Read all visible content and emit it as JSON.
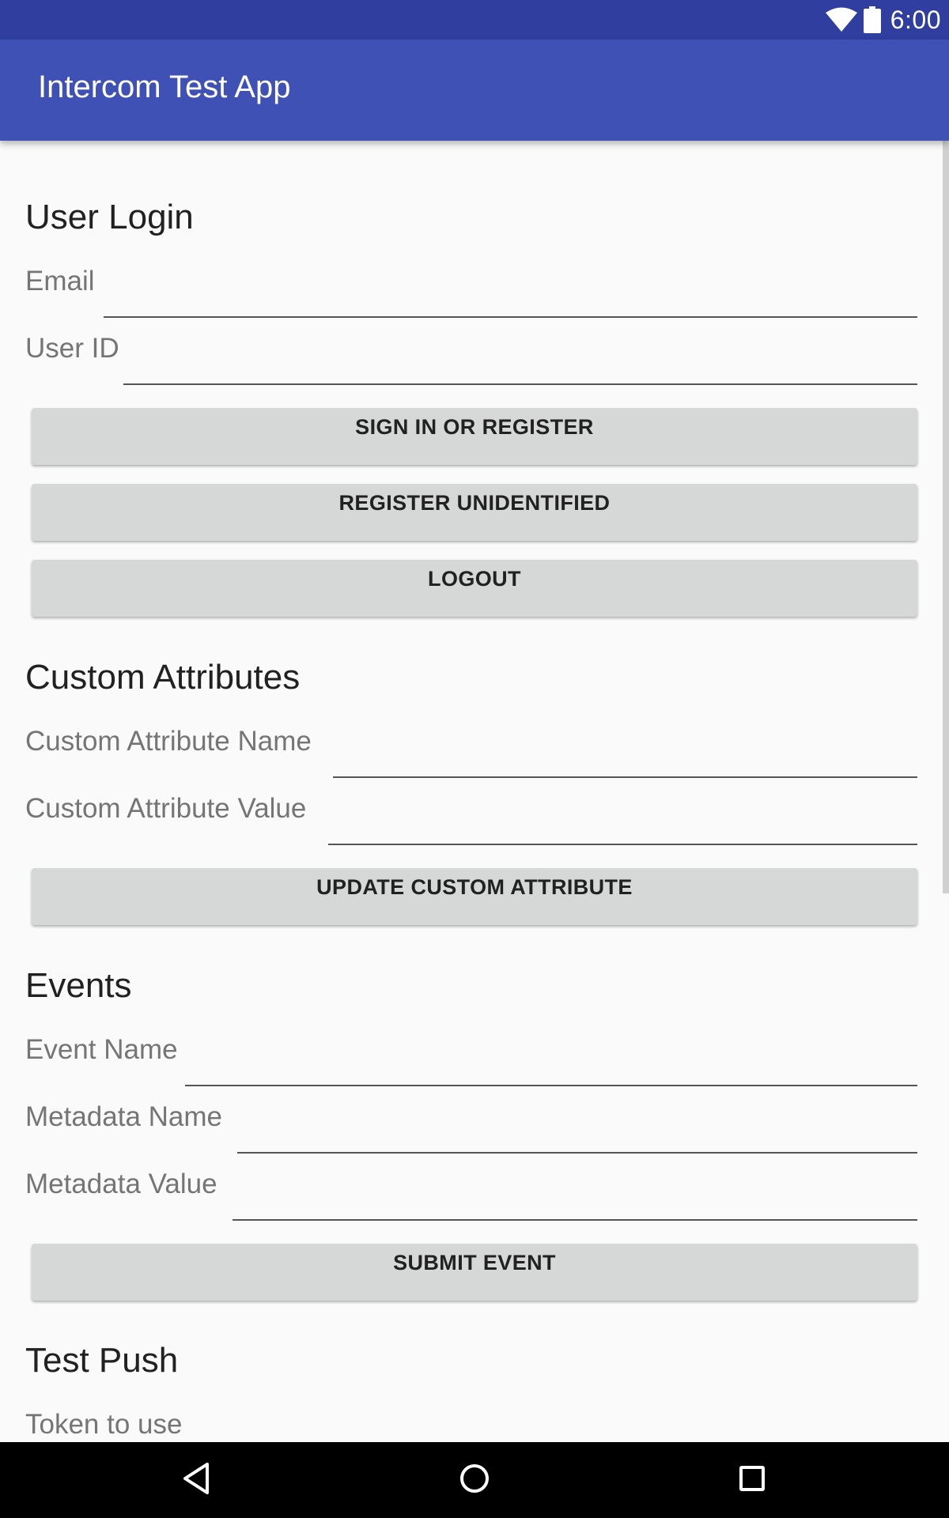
{
  "status_bar": {
    "time": "6:00",
    "icons": [
      "wifi-icon",
      "battery-icon"
    ]
  },
  "app_bar": {
    "title": "Intercom Test App"
  },
  "sections": {
    "user_login": {
      "title": "User Login",
      "fields": {
        "email": {
          "label": "Email",
          "value": ""
        },
        "user_id": {
          "label": "User ID",
          "value": ""
        }
      },
      "buttons": {
        "sign_in": "SIGN IN OR REGISTER",
        "register_unidentified": "REGISTER UNIDENTIFIED",
        "logout": "LOGOUT"
      }
    },
    "custom_attributes": {
      "title": "Custom Attributes",
      "fields": {
        "name": {
          "label": "Custom Attribute Name",
          "value": ""
        },
        "value": {
          "label": "Custom Attribute Value",
          "value": ""
        }
      },
      "buttons": {
        "update": "UPDATE CUSTOM ATTRIBUTE"
      }
    },
    "events": {
      "title": "Events",
      "fields": {
        "event_name": {
          "label": "Event Name",
          "value": ""
        },
        "metadata_name": {
          "label": "Metadata Name",
          "value": ""
        },
        "metadata_value": {
          "label": "Metadata Value",
          "value": ""
        }
      },
      "buttons": {
        "submit": "SUBMIT EVENT"
      }
    },
    "test_push": {
      "title": "Test Push",
      "fields": {
        "token": {
          "label": "Token to use"
        }
      }
    }
  },
  "nav_bar": {
    "icons": [
      "back-icon",
      "home-icon",
      "recents-icon"
    ]
  },
  "colors": {
    "status_bar": "#303f9f",
    "app_bar": "#3f51b5",
    "background": "#fafafa",
    "button": "#d6d7d7",
    "label": "#757575"
  }
}
